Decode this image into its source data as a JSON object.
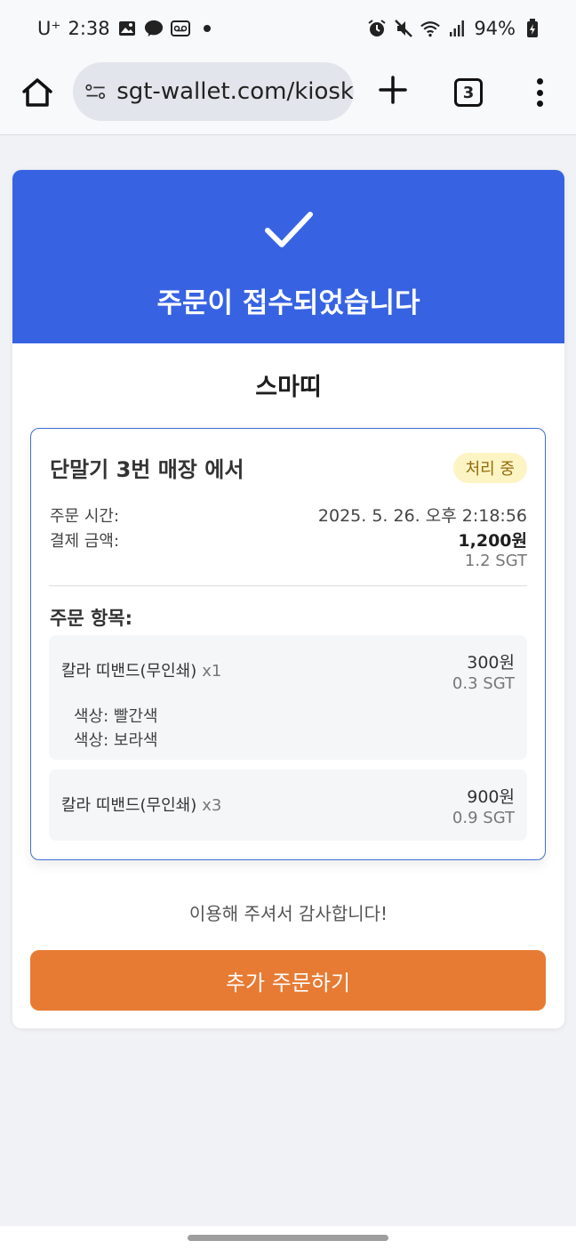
{
  "status_bar": {
    "carrier": "U⁺",
    "time": "2:38",
    "battery": "94%",
    "icons": [
      "gallery-icon",
      "kakaotalk-icon",
      "voicemail-icon",
      "dot-icon",
      "alarm-icon",
      "mute-icon",
      "wifi-icon",
      "signal-icon",
      "battery-charging-icon"
    ]
  },
  "browser": {
    "url": "sgt-wallet.com/kiosk",
    "tab_count": "3",
    "icons": [
      "home-icon",
      "site-settings-icon",
      "plus-icon",
      "more-vert-icon"
    ]
  },
  "header": {
    "title": "주문이 접수되었습니다",
    "icon": "check-icon",
    "color": "#3763e3"
  },
  "store": {
    "name": "스마띠"
  },
  "order": {
    "location": "단말기 3번 매장 에서",
    "status_badge": "처리 중",
    "time_label": "주문 시간:",
    "time_value": "2025. 5. 26. 오후 2:18:56",
    "amount_label": "결제 금액:",
    "amount_won": "1,200원",
    "amount_sgt": "1.2 SGT",
    "items_title": "주문 항목:",
    "items": [
      {
        "name": "칼라 띠밴드(무인쇄)",
        "qty": "x1",
        "price_won": "300원",
        "price_sgt": "0.3 SGT",
        "options": [
          "색상: 빨간색",
          "색상: 보라색"
        ]
      },
      {
        "name": "칼라 띠밴드(무인쇄)",
        "qty": "x3",
        "price_won": "900원",
        "price_sgt": "0.9 SGT",
        "options": []
      }
    ]
  },
  "footer": {
    "thanks": "이용해 주셔서 감사합니다!",
    "cta": "추가 주문하기",
    "cta_color": "#e77b33"
  }
}
